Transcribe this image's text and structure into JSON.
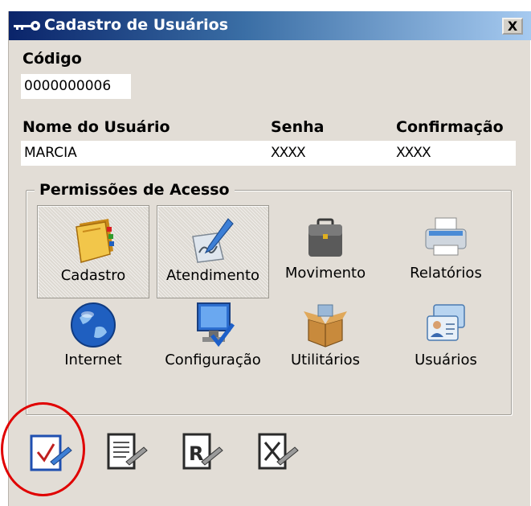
{
  "window": {
    "title": "Cadastro de Usuários",
    "close_label": "X"
  },
  "form": {
    "codigo_label": "Código",
    "codigo_value": "0000000006",
    "nome_label": "Nome do Usuário",
    "nome_value": "MARCIA",
    "senha_label": "Senha",
    "senha_value": "XXXX",
    "confirmacao_label": "Confirmação",
    "confirmacao_value": "XXXX"
  },
  "permissions": {
    "title": "Permissões de Acesso",
    "items": [
      {
        "label": "Cadastro",
        "icon": "address-book-icon",
        "selected": true
      },
      {
        "label": "Atendimento",
        "icon": "pen-tablet-icon",
        "selected": true
      },
      {
        "label": "Movimento",
        "icon": "briefcase-icon",
        "selected": false
      },
      {
        "label": "Relatórios",
        "icon": "printer-icon",
        "selected": false
      },
      {
        "label": "Internet",
        "icon": "globe-icon",
        "selected": false
      },
      {
        "label": "Configuração",
        "icon": "monitor-check-icon",
        "selected": false
      },
      {
        "label": "Utilitários",
        "icon": "open-box-icon",
        "selected": false
      },
      {
        "label": "Usuários",
        "icon": "user-cards-icon",
        "selected": false
      }
    ]
  },
  "toolbar": {
    "buttons": [
      "save-check-icon",
      "edit-document-icon",
      "rename-document-icon",
      "delete-document-icon"
    ],
    "highlight_color": "#e00000"
  },
  "colors": {
    "title_start": "#0a246a",
    "title_end": "#a6caf0",
    "dialog_bg": "#e2ddd6"
  }
}
